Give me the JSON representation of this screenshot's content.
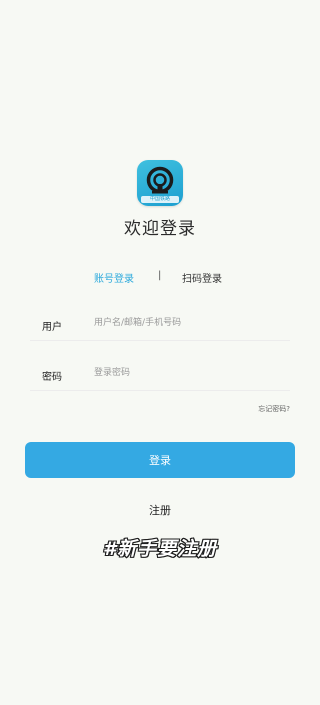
{
  "app": {
    "icon_name": "railway-train-icon",
    "icon_caption": "中国铁路",
    "welcome_title": "欢迎登录"
  },
  "login_tabs": [
    {
      "label": "账号登录",
      "active": true
    },
    {
      "label": "扫码登录",
      "active": false
    }
  ],
  "tab_divider": "|",
  "form": {
    "username_label": "用户",
    "username_placeholder": "用户名/邮箱/手机号码",
    "password_label": "密码",
    "password_placeholder": "登录密码"
  },
  "forgot_password": "忘记密码?",
  "login_button": "登录",
  "register_link": "注册",
  "promo_caption": "#新手要注册",
  "colors": {
    "accent": "#34a9e3",
    "background": "#f7f9f4"
  }
}
